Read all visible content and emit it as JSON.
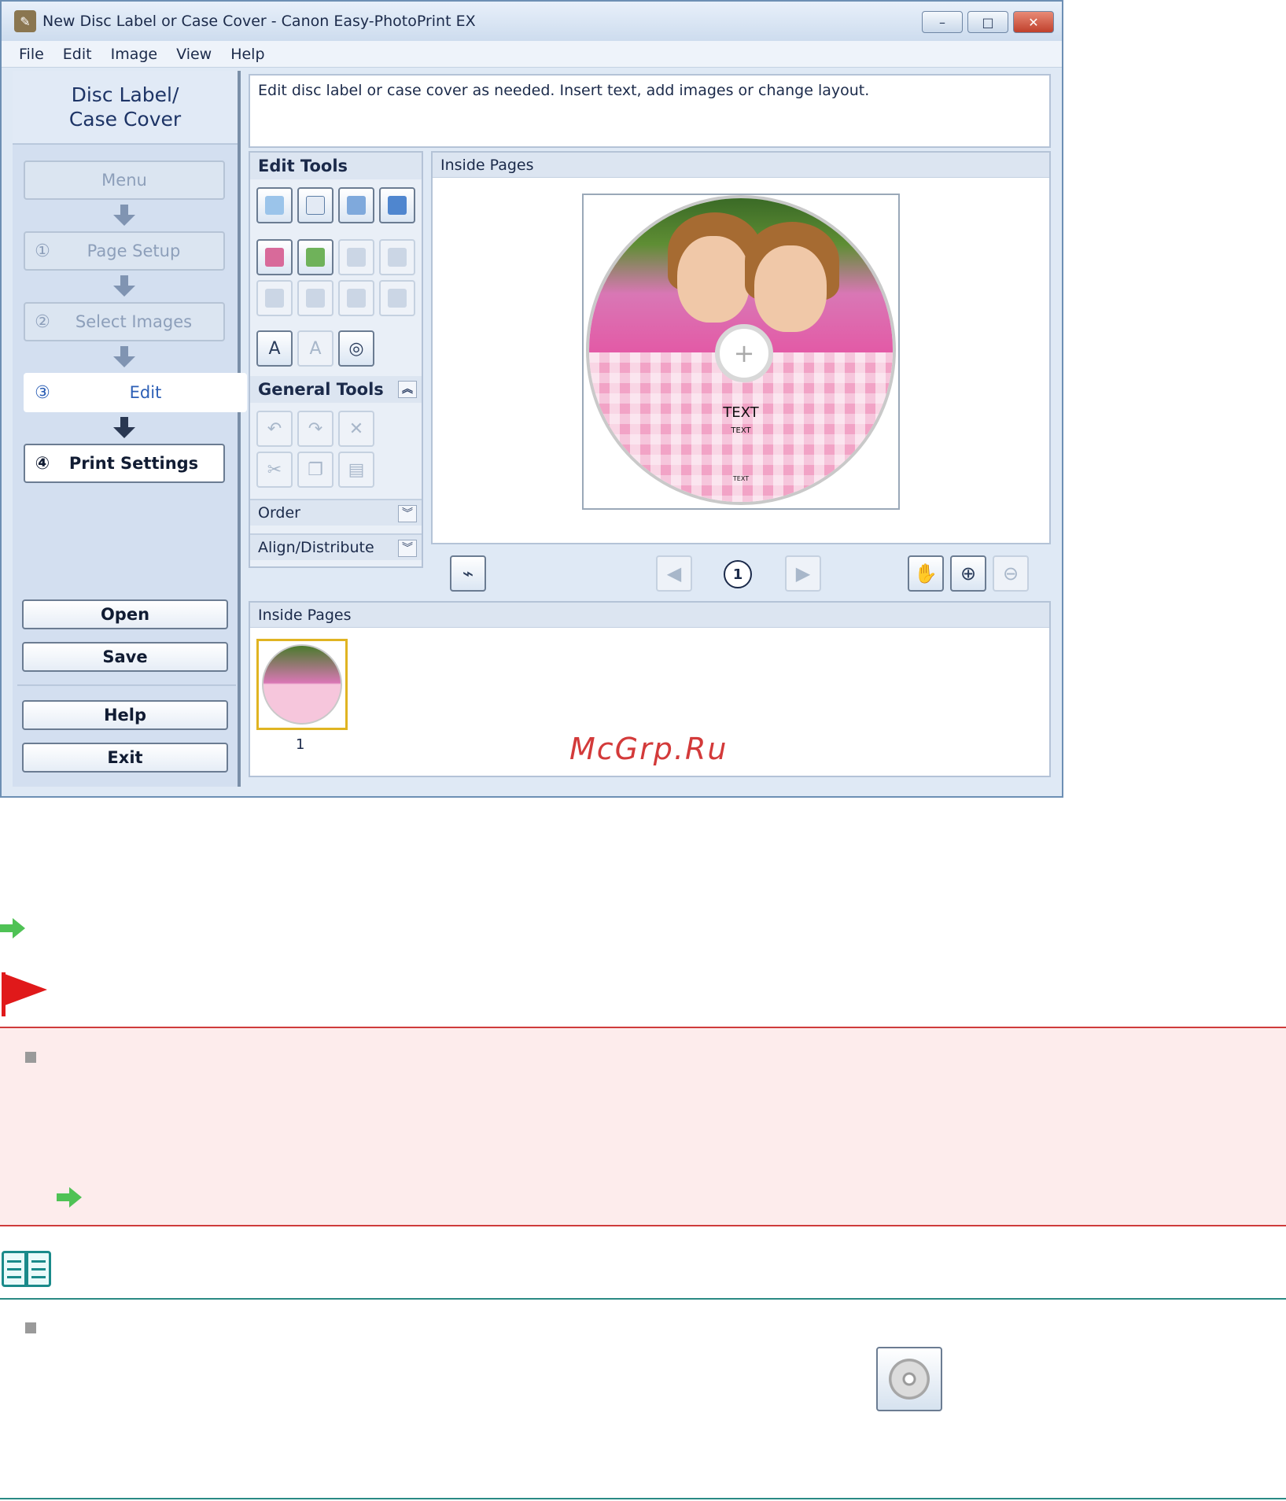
{
  "window": {
    "title": "New Disc Label or Case Cover - Canon Easy-PhotoPrint EX",
    "controls": [
      "–",
      "□",
      "✕"
    ]
  },
  "menubar": [
    "File",
    "Edit",
    "Image",
    "View",
    "Help"
  ],
  "sidebar": {
    "header_line1": "Disc Label/",
    "header_line2": "Case Cover",
    "steps": [
      {
        "num": "",
        "label": "Menu"
      },
      {
        "num": "①",
        "label": "Page Setup"
      },
      {
        "num": "②",
        "label": "Select Images"
      },
      {
        "num": "③",
        "label": "Edit"
      },
      {
        "num": "④",
        "label": "Print Settings"
      }
    ],
    "buttons": {
      "open": "Open",
      "save": "Save",
      "help": "Help",
      "exit": "Exit"
    }
  },
  "description": "Edit disc label or case cover as needed. Insert text, add images or change layout.",
  "tools": {
    "edit_tools": "Edit Tools",
    "general_tools": "General Tools",
    "order": "Order",
    "align": "Align/Distribute"
  },
  "preview": {
    "title": "Inside Pages",
    "text_large": "TEXT",
    "text_small1": "TEXT",
    "text_small2": "TEXT"
  },
  "navigation": {
    "page_number": "1"
  },
  "thumbnails": {
    "title": "Inside Pages",
    "items": [
      {
        "number": "1",
        "selected": true
      }
    ]
  },
  "watermark": "McGrp.Ru",
  "colors": {
    "important_border": "#cf3b3b",
    "important_bg": "#fdecec",
    "note_rule": "#2a8a84",
    "link_arrow": "#4fc255",
    "flag": "#e0191a"
  },
  "icons": {
    "link_arrow": "green-arrow-icon",
    "important": "red-flag-icon",
    "note": "open-book-icon",
    "disc_button": "disc-icon"
  }
}
